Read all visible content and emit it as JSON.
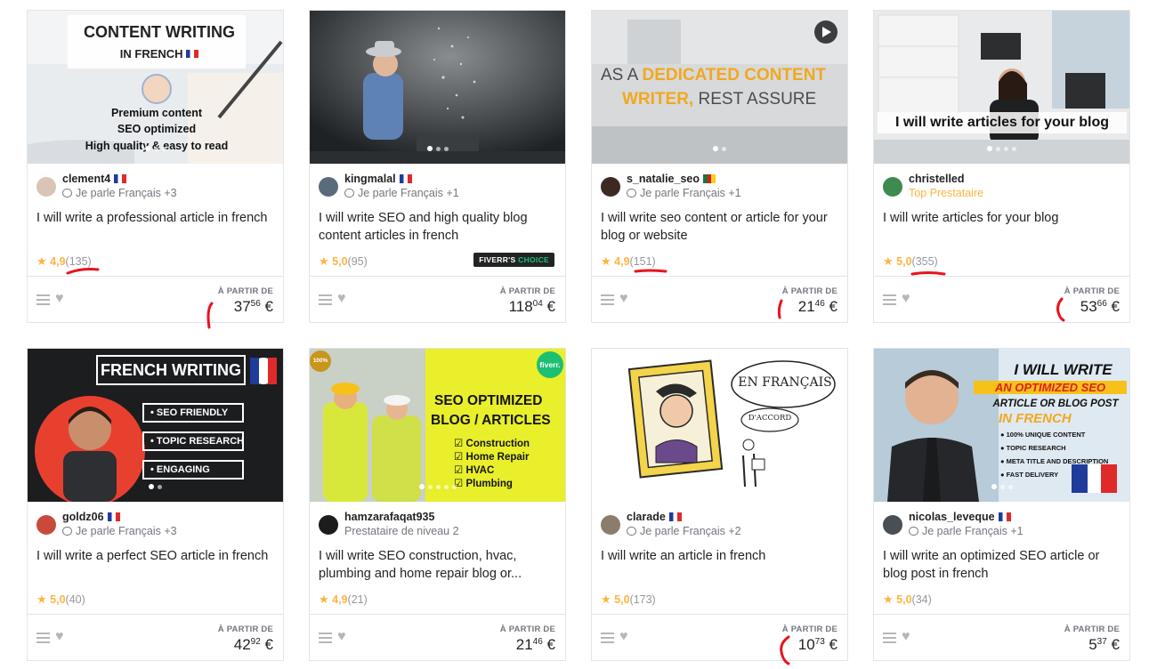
{
  "labels": {
    "from": "À PARTIR DE",
    "choice_a": "FIVERR'S",
    "choice_b": "CHOICE"
  },
  "colors": {
    "star": "#ffb33e",
    "annotation_red": "#e8141c",
    "choice_green": "#1dbf73"
  },
  "cards": [
    {
      "image_text": {
        "line1": "CONTENT WRITING",
        "line2": "IN FRENCH",
        "line3": "Premium content",
        "line4": "SEO optimized",
        "line5": "High quality & easy to read"
      },
      "seller": "clement4",
      "subtitle": "Je parle Français +3",
      "title": "I will write a professional article in french",
      "score": "4,9",
      "count": "(135)",
      "price_int": "37",
      "price_dec": "56",
      "currency": "€"
    },
    {
      "image_text": {},
      "seller": "kingmalal",
      "subtitle": "Je parle Français +1",
      "title": "I will write SEO and high quality blog content articles in french",
      "score": "5,0",
      "count": "(95)",
      "price_int": "118",
      "price_dec": "04",
      "currency": "€"
    },
    {
      "image_text": {
        "line1": "AS A",
        "line2": "DEDICATED CONTENT",
        "line3": "WRITER,",
        "line4": "REST ASSURE"
      },
      "seller": "s_natalie_seo",
      "subtitle": "Je parle Français +1",
      "title": "I will write seo content or article for your blog or website",
      "score": "4,9",
      "count": "(151)",
      "price_int": "21",
      "price_dec": "46",
      "currency": "€"
    },
    {
      "image_text": {
        "line1": "I will write articles for your blog"
      },
      "seller": "christelled",
      "subtitle": "Top Prestataire",
      "title": "I will write articles for your blog",
      "score": "5,0",
      "count": "(355)",
      "price_int": "53",
      "price_dec": "66",
      "currency": "€"
    },
    {
      "image_text": {
        "line1": "FRENCH WRITING",
        "line2": "• SEO FRIENDLY",
        "line3": "• TOPIC RESEARCH",
        "line4": "• ENGAGING"
      },
      "seller": "goldz06",
      "subtitle": "Je parle Français +3",
      "title": "I will write a perfect SEO article in french",
      "score": "5,0",
      "count": "(40)",
      "price_int": "42",
      "price_dec": "92",
      "currency": "€"
    },
    {
      "image_text": {
        "line1": "SEO OPTIMIZED",
        "line2": "BLOG / ARTICLES",
        "line3": "Construction",
        "line4": "Home Repair",
        "line5": "HVAC",
        "line6": "Plumbing",
        "badge": "fiverr.",
        "seal": "100%"
      },
      "seller": "hamzarafaqat935",
      "subtitle": "Prestataire de niveau 2",
      "title": "I will write SEO construction, hvac, plumbing and home repair blog or...",
      "score": "4,9",
      "count": "(21)",
      "price_int": "21",
      "price_dec": "46",
      "currency": "€"
    },
    {
      "image_text": {
        "line1": "EN FRANÇAIS",
        "line2": "D'ACCORD"
      },
      "seller": "clarade",
      "subtitle": "Je parle Français +2",
      "title": "I will write an article in french",
      "score": "5,0",
      "count": "(173)",
      "price_int": "10",
      "price_dec": "73",
      "currency": "€"
    },
    {
      "image_text": {
        "line1": "I WILL WRITE",
        "line2": "AN OPTIMIZED SEO",
        "line3": "ARTICLE OR BLOG POST",
        "line4": "IN FRENCH",
        "line5": "100% UNIQUE CONTENT",
        "line6": "TOPIC RESEARCH",
        "line7": "META TITLE AND DESCRIPTION",
        "line8": "FAST DELIVERY"
      },
      "seller": "nicolas_leveque",
      "subtitle": "Je parle Français +1",
      "title": "I will write an optimized SEO article or blog post in french",
      "score": "5,0",
      "count": "(34)",
      "price_int": "5",
      "price_dec": "37",
      "currency": "€"
    }
  ]
}
